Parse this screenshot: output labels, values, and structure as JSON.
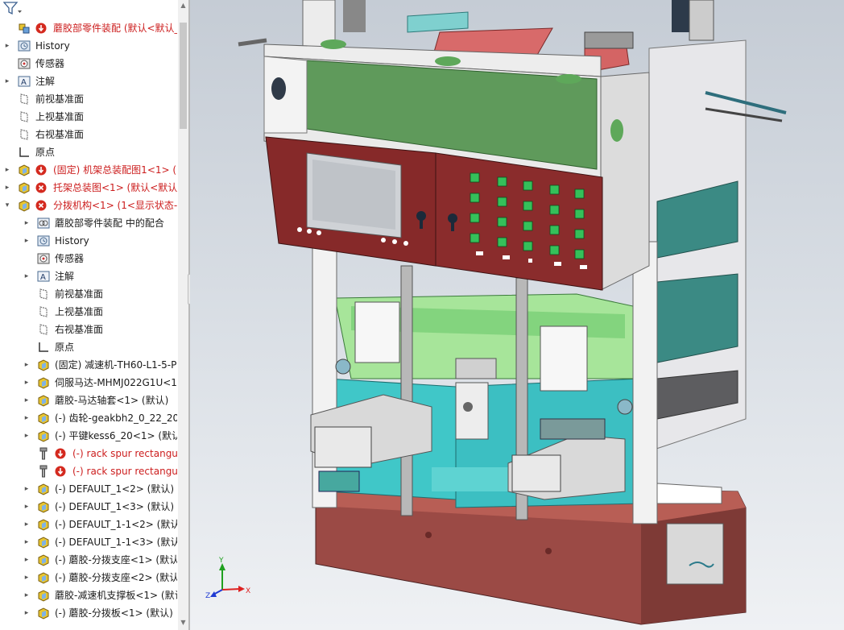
{
  "tree": {
    "items": [
      {
        "label": "蘑胶部零件装配  (默认<默认_显",
        "arrow": "",
        "red": true,
        "indent": 0
      },
      {
        "label": "History",
        "arrow": "▸",
        "red": false,
        "indent": 0
      },
      {
        "label": "传感器",
        "arrow": "",
        "red": false,
        "indent": 0
      },
      {
        "label": "注解",
        "arrow": "▸",
        "red": false,
        "indent": 0
      },
      {
        "label": "前视基准面",
        "arrow": "",
        "red": false,
        "indent": 0
      },
      {
        "label": "上视基准面",
        "arrow": "",
        "red": false,
        "indent": 0
      },
      {
        "label": "右视基准面",
        "arrow": "",
        "red": false,
        "indent": 0
      },
      {
        "label": "原点",
        "arrow": "",
        "red": false,
        "indent": 0
      },
      {
        "label": "(固定) 机架总装配图1<1> (",
        "arrow": "▸",
        "red": true,
        "indent": 0
      },
      {
        "label": "托架总装图<1> (默认<默认",
        "arrow": "▸",
        "red": true,
        "indent": 0
      },
      {
        "label": "分拨机构<1> (1<显示状态-",
        "arrow": "▾",
        "red": true,
        "indent": 0
      },
      {
        "label": "蘑胶部零件装配 中的配合",
        "arrow": "▸",
        "red": false,
        "indent": 1
      },
      {
        "label": "History",
        "arrow": "▸",
        "red": false,
        "indent": 1
      },
      {
        "label": "传感器",
        "arrow": "",
        "red": false,
        "indent": 1
      },
      {
        "label": "注解",
        "arrow": "▸",
        "red": false,
        "indent": 1
      },
      {
        "label": "前视基准面",
        "arrow": "",
        "red": false,
        "indent": 1
      },
      {
        "label": "上视基准面",
        "arrow": "",
        "red": false,
        "indent": 1
      },
      {
        "label": "右视基准面",
        "arrow": "",
        "red": false,
        "indent": 1
      },
      {
        "label": "原点",
        "arrow": "",
        "red": false,
        "indent": 1
      },
      {
        "label": "(固定) 减速机-TH60-L1-5-P",
        "arrow": "▸",
        "red": false,
        "indent": 1
      },
      {
        "label": "伺服马达-MHMJ022G1U<1",
        "arrow": "▸",
        "red": false,
        "indent": 1
      },
      {
        "label": "蘑胶-马达轴套<1> (默认)",
        "arrow": "▸",
        "red": false,
        "indent": 1
      },
      {
        "label": "(-) 齿轮-geakbh2_0_22_20_",
        "arrow": "▸",
        "red": false,
        "indent": 1
      },
      {
        "label": "(-) 平键kess6_20<1> (默认",
        "arrow": "▸",
        "red": false,
        "indent": 1
      },
      {
        "label": "(-) rack spur rectangu",
        "arrow": "",
        "red": true,
        "indent": 1
      },
      {
        "label": "(-) rack spur rectangu",
        "arrow": "",
        "red": true,
        "indent": 1
      },
      {
        "label": "(-) DEFAULT_1<2> (默认)",
        "arrow": "▸",
        "red": false,
        "indent": 1
      },
      {
        "label": "(-) DEFAULT_1<3> (默认)",
        "arrow": "▸",
        "red": false,
        "indent": 1
      },
      {
        "label": "(-) DEFAULT_1-1<2> (默认)",
        "arrow": "▸",
        "red": false,
        "indent": 1
      },
      {
        "label": "(-) DEFAULT_1-1<3> (默认)",
        "arrow": "▸",
        "red": false,
        "indent": 1
      },
      {
        "label": "(-) 蘑胶-分拨支座<1> (默认",
        "arrow": "▸",
        "red": false,
        "indent": 1
      },
      {
        "label": "(-) 蘑胶-分拨支座<2> (默认",
        "arrow": "▸",
        "red": false,
        "indent": 1
      },
      {
        "label": "蘑胶-减速机支撑板<1> (默认",
        "arrow": "▸",
        "red": false,
        "indent": 1
      },
      {
        "label": "(-) 蘑胶-分拨板<1> (默认)",
        "arrow": "▸",
        "red": false,
        "indent": 1
      }
    ]
  },
  "icons": {
    "filter": "filter-icon",
    "assembly": "assembly-icon",
    "history": "history-icon",
    "sensor": "sensor-icon",
    "annotation": "annotation-icon",
    "plane": "plane-icon",
    "origin": "origin-icon",
    "part": "part-icon",
    "screw": "screw-icon",
    "error": "error-icon",
    "warning": "warning-icon",
    "mates": "mates-icon"
  },
  "triad": {
    "y_label": "Y",
    "x_label": "X",
    "z_label": "Z"
  },
  "colors": {
    "error_red": "#d42a1f",
    "part_yellow": "#e8c531",
    "frame_maroon": "#8a2a2a",
    "panel_green": "#5f9a5b",
    "cyan_plate": "#3fc6c6"
  }
}
